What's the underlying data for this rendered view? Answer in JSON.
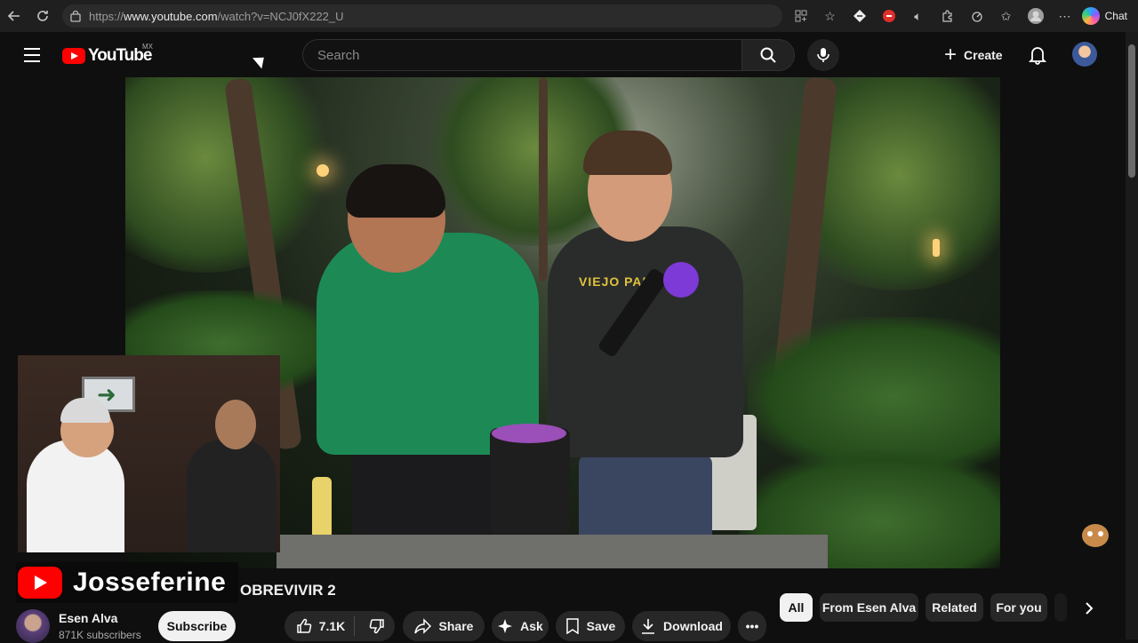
{
  "browser": {
    "url_prefix": "https://",
    "url_domain": "www.youtube.com",
    "url_path": "/watch?v=NCJ0fX222_U",
    "chat_label": "Chat"
  },
  "header": {
    "logo_text": "YouTube",
    "region": "MX",
    "search_placeholder": "Search",
    "create_label": "Create"
  },
  "video": {
    "shirt_text": "VIEJO PAD",
    "overlay_name": "Josseferine",
    "title_visible": "OBREVIVIR 2"
  },
  "channel": {
    "name": "Esen Alva",
    "subscribers": "871K subscribers",
    "subscribe_label": "Subscribe"
  },
  "actions": {
    "likes": "7.1K",
    "share": "Share",
    "ask": "Ask",
    "save": "Save",
    "download": "Download"
  },
  "chips": [
    "All",
    "From Esen Alva",
    "Related",
    "For you"
  ],
  "colors": {
    "brand_red": "#ff0000",
    "background": "#0f0f0f",
    "chip_bg": "#272727"
  }
}
